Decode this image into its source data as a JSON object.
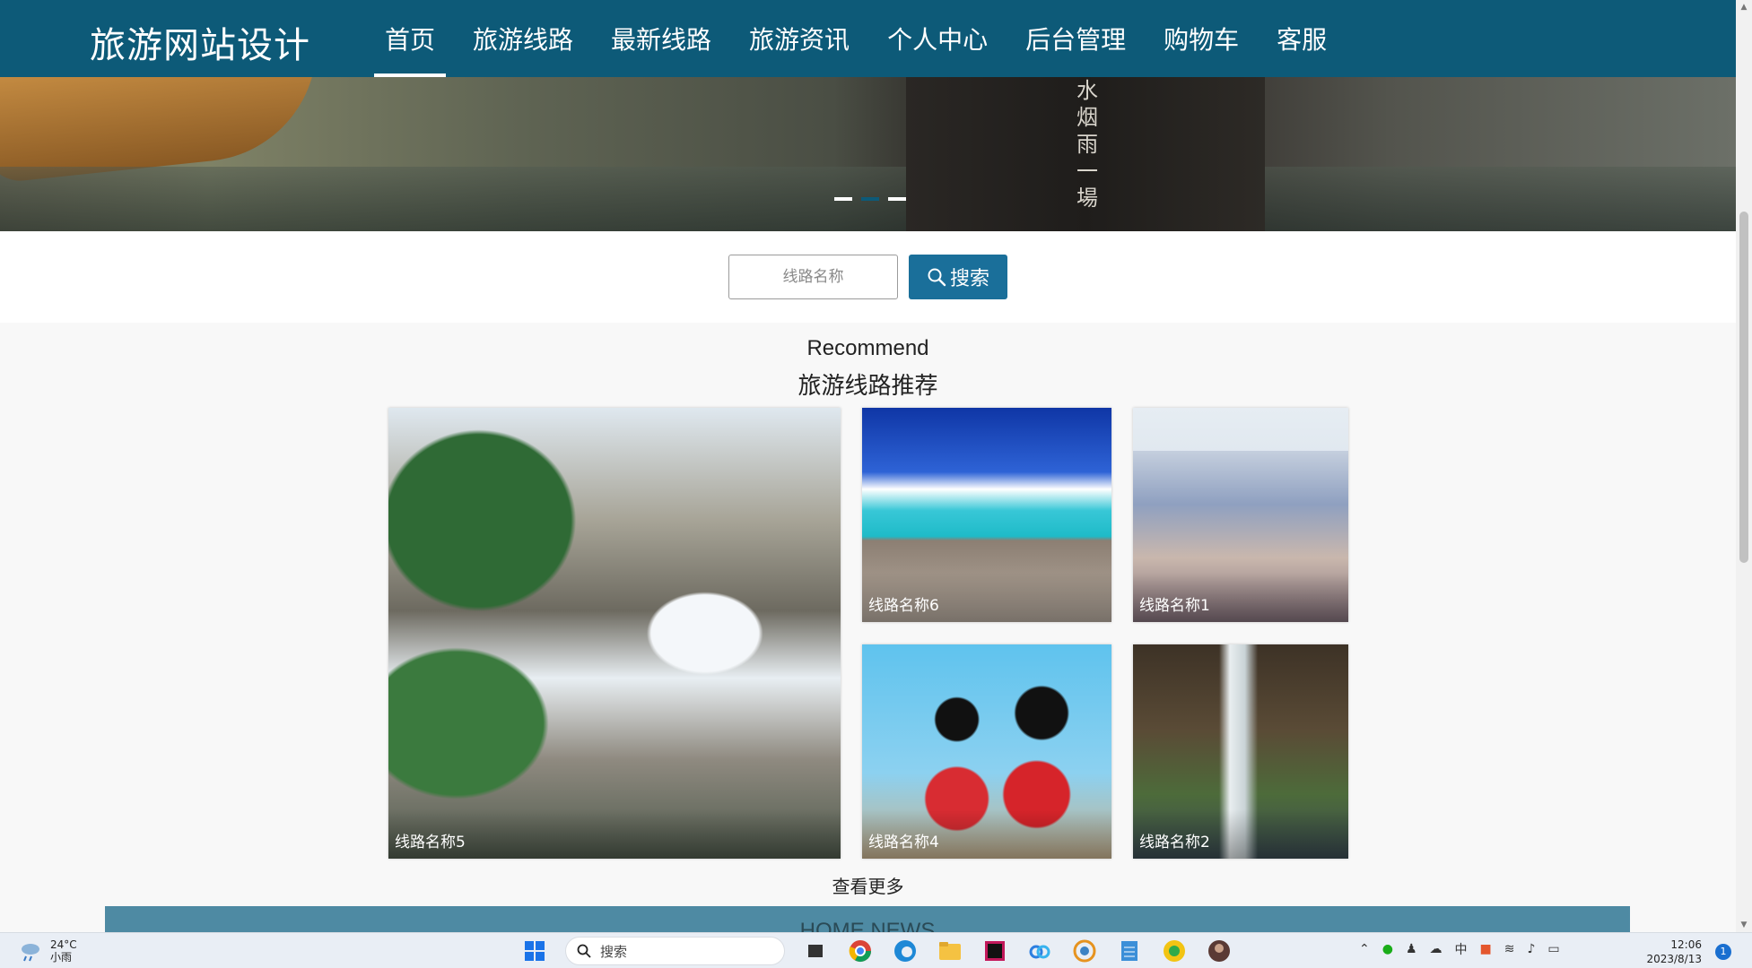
{
  "header": {
    "brand": "旅游网站设计",
    "nav": [
      {
        "label": "首页",
        "active": true
      },
      {
        "label": "旅游线路"
      },
      {
        "label": "最新线路"
      },
      {
        "label": "旅游资讯"
      },
      {
        "label": "个人中心"
      },
      {
        "label": "后台管理"
      },
      {
        "label": "购物车"
      },
      {
        "label": "客服"
      }
    ]
  },
  "banner": {
    "vertical_text": "水烟雨一場",
    "active_dot": 2
  },
  "search": {
    "placeholder": "线路名称",
    "button_label": "搜索"
  },
  "recommend": {
    "title_en": "Recommend",
    "title_cn": "旅游线路推荐",
    "cards": [
      {
        "caption": "线路名称5"
      },
      {
        "caption": "线路名称6"
      },
      {
        "caption": "线路名称1"
      },
      {
        "caption": "线路名称4"
      },
      {
        "caption": "线路名称2"
      }
    ],
    "more_label": "查看更多"
  },
  "news": {
    "title": "HOME NEWS"
  },
  "taskbar": {
    "weather_temp": "24°C",
    "weather_desc": "小雨",
    "search_label": "搜索",
    "ime": "中",
    "time": "12:06",
    "date": "2023/8/13",
    "notification_count": "1"
  },
  "colors": {
    "header_bg": "#0d5a78",
    "search_button": "#1a6f9a",
    "news_bar": "#4e8aa3"
  }
}
